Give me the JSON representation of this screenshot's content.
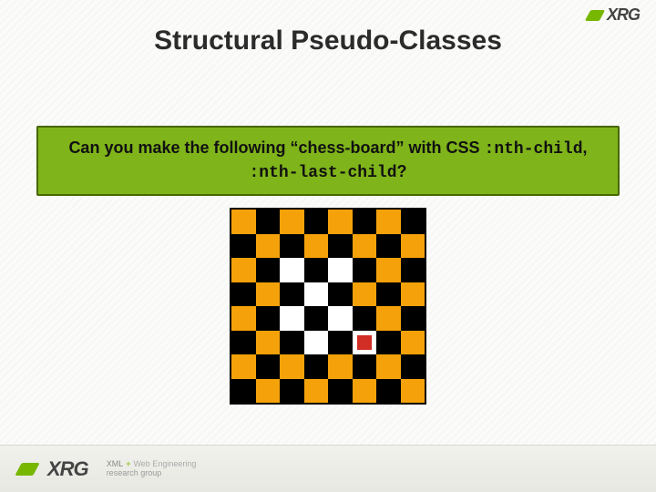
{
  "title": "Structural Pseudo-Classes",
  "logo": {
    "brand": "XRG"
  },
  "banner": {
    "part1": "Can you make the following “chess-board” with CSS ",
    "code1": ":nth-child",
    "sep": ", ",
    "code2": ":nth-last-child",
    "end": "?"
  },
  "footer": {
    "xml": "XML",
    "plus": "+",
    "webeng": "Web Engineering",
    "research": "research group"
  },
  "board": {
    "size": 8,
    "rows": [
      "OBOBOBOB",
      "BOBOBOBO",
      "OBWBWBOB",
      "BOBWBOBO",
      "OBWBWBOB",
      "BOBWBMBO",
      "OBOBOBOB",
      "BOBOBOBO"
    ],
    "legend": {
      "O": "orange",
      "B": "black",
      "W": "white",
      "M": "white-with-marker"
    }
  }
}
